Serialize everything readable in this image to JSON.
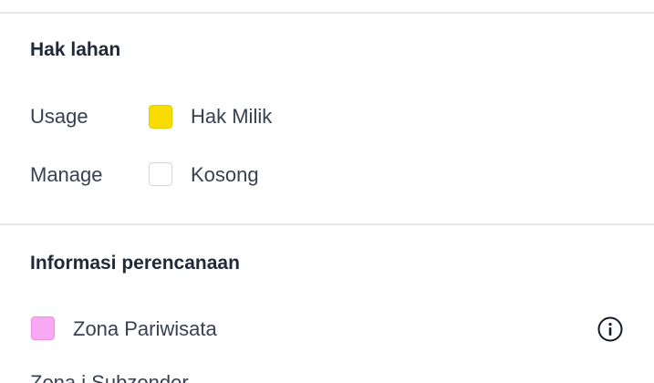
{
  "land_rights": {
    "title": "Hak lahan",
    "rows": [
      {
        "label": "Usage",
        "value": "Hak Milik",
        "color": "#F9DC00"
      },
      {
        "label": "Manage",
        "value": "Kosong",
        "color": "#FFFFFF"
      }
    ]
  },
  "planning": {
    "title": "Informasi perencanaan",
    "zone": {
      "value": "Zona Pariwisata",
      "color": "#F9A8F4",
      "icon": "info-icon"
    },
    "next_partial_label": "Zona j Subzonder"
  }
}
